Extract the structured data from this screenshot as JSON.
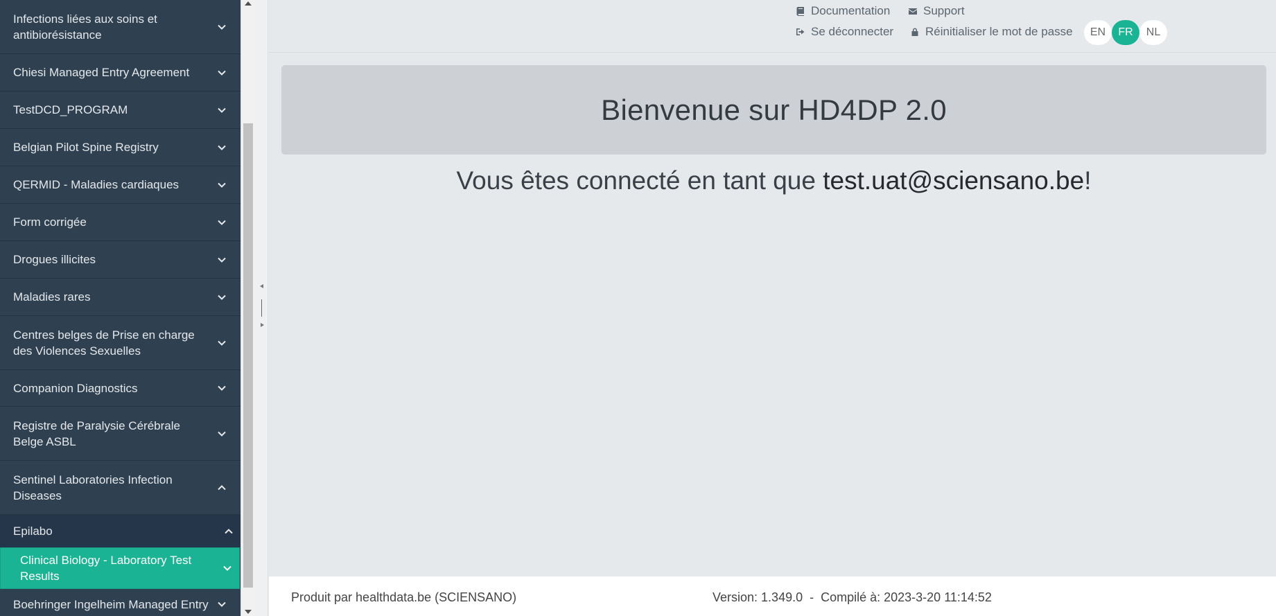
{
  "sidebar": {
    "items": [
      {
        "label": "Infections liées aux soins et antibiorésistance",
        "icon": "chevron-down-icon"
      },
      {
        "label": "Chiesi Managed Entry Agreement",
        "icon": "chevron-down-icon"
      },
      {
        "label": "TestDCD_PROGRAM",
        "icon": "chevron-down-icon"
      },
      {
        "label": "Belgian Pilot Spine Registry",
        "icon": "chevron-down-icon"
      },
      {
        "label": "QERMID - Maladies cardiaques",
        "icon": "chevron-down-icon"
      },
      {
        "label": "Form corrigée",
        "icon": "chevron-down-icon"
      },
      {
        "label": "Drogues illicites",
        "icon": "chevron-down-icon"
      },
      {
        "label": "Maladies rares",
        "icon": "chevron-down-icon"
      },
      {
        "label": "Centres belges de Prise en charge des Violences Sexuelles",
        "icon": "chevron-down-icon"
      },
      {
        "label": "Companion Diagnostics",
        "icon": "chevron-down-icon"
      },
      {
        "label": "Registre de Paralysie Cérébrale Belge ASBL",
        "icon": "chevron-down-icon"
      },
      {
        "label": "Sentinel Laboratories Infection Diseases",
        "icon": "chevron-up-icon"
      },
      {
        "label": "Epilabo",
        "icon": "chevron-up-icon"
      },
      {
        "label": "Clinical Biology - Laboratory Test Results",
        "icon": "chevron-down-icon"
      },
      {
        "label": "Boehringer Ingelheim Managed Entry",
        "icon": "chevron-down-icon"
      }
    ]
  },
  "header": {
    "documentation": "Documentation",
    "support": "Support",
    "logout": "Se déconnecter",
    "reset_password": "Réinitialiser le mot de passe",
    "languages": [
      "EN",
      "FR",
      "NL"
    ],
    "selected_language": "FR"
  },
  "main": {
    "welcome_title": "Bienvenue sur HD4DP 2.0",
    "connected_prefix": "Vous êtes connecté en tant que ",
    "connected_email": "test.uat@sciensano.be",
    "connected_suffix": "!"
  },
  "footer": {
    "produced_by": "Produit par healthdata.be (SCIENSANO)",
    "version": "Version: 1.349.0  -  Compilé à: 2023-3-20 11:14:52"
  },
  "colors": {
    "sidebar_bg": "#2f4050",
    "accent": "#1ab394",
    "page_bg": "#e6e9ec"
  }
}
